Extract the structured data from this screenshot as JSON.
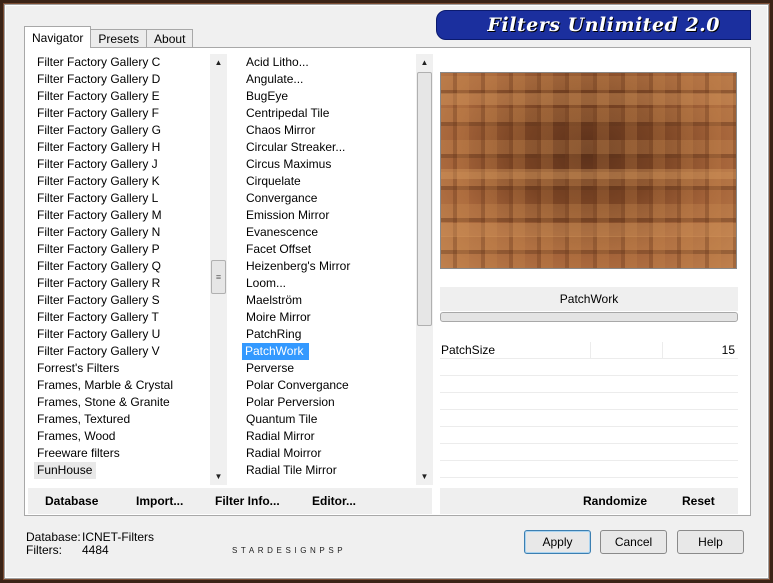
{
  "banner": {
    "title": "Filters Unlimited 2.0"
  },
  "tabs": [
    {
      "label": "Navigator",
      "active": true
    },
    {
      "label": "Presets",
      "active": false
    },
    {
      "label": "About",
      "active": false
    }
  ],
  "categories": {
    "items": [
      "Filter Factory Gallery C",
      "Filter Factory Gallery D",
      "Filter Factory Gallery E",
      "Filter Factory Gallery F",
      "Filter Factory Gallery G",
      "Filter Factory Gallery H",
      "Filter Factory Gallery J",
      "Filter Factory Gallery K",
      "Filter Factory Gallery L",
      "Filter Factory Gallery M",
      "Filter Factory Gallery N",
      "Filter Factory Gallery P",
      "Filter Factory Gallery Q",
      "Filter Factory Gallery R",
      "Filter Factory Gallery S",
      "Filter Factory Gallery T",
      "Filter Factory Gallery U",
      "Filter Factory Gallery V",
      "Forrest's Filters",
      "Frames, Marble & Crystal",
      "Frames, Stone & Granite",
      "Frames, Textured",
      "Frames, Wood",
      "Freeware filters",
      "FunHouse"
    ],
    "selected": "FunHouse"
  },
  "filters": {
    "items": [
      "Acid Litho...",
      "Angulate...",
      "BugEye",
      "Centripedal Tile",
      "Chaos Mirror",
      "Circular Streaker...",
      "Circus Maximus",
      "Cirquelate",
      "Convergance",
      "Emission Mirror",
      "Evanescence",
      "Facet Offset",
      "Heizenberg's Mirror",
      "Loom...",
      "Maelström",
      "Moire Mirror",
      "PatchRing",
      "PatchWork",
      "Perverse",
      "Polar Convergance",
      "Polar Perversion",
      "Quantum Tile",
      "Radial Mirror",
      "Radial Moirror",
      "Radial Tile Mirror"
    ],
    "selected": "PatchWork"
  },
  "filter_name": "PatchWork",
  "params": [
    {
      "name": "PatchSize",
      "value": "15"
    }
  ],
  "actions": {
    "database": "Database",
    "import": "Import...",
    "filter_info": "Filter Info...",
    "editor": "Editor...",
    "randomize": "Randomize",
    "reset": "Reset"
  },
  "status": {
    "database_label": "Database:",
    "database_value": "ICNET-Filters",
    "filters_label": "Filters:",
    "filters_value": "4484"
  },
  "watermark": "STARDESIGNPSP",
  "buttons": {
    "apply": "Apply",
    "cancel": "Cancel",
    "help": "Help"
  }
}
